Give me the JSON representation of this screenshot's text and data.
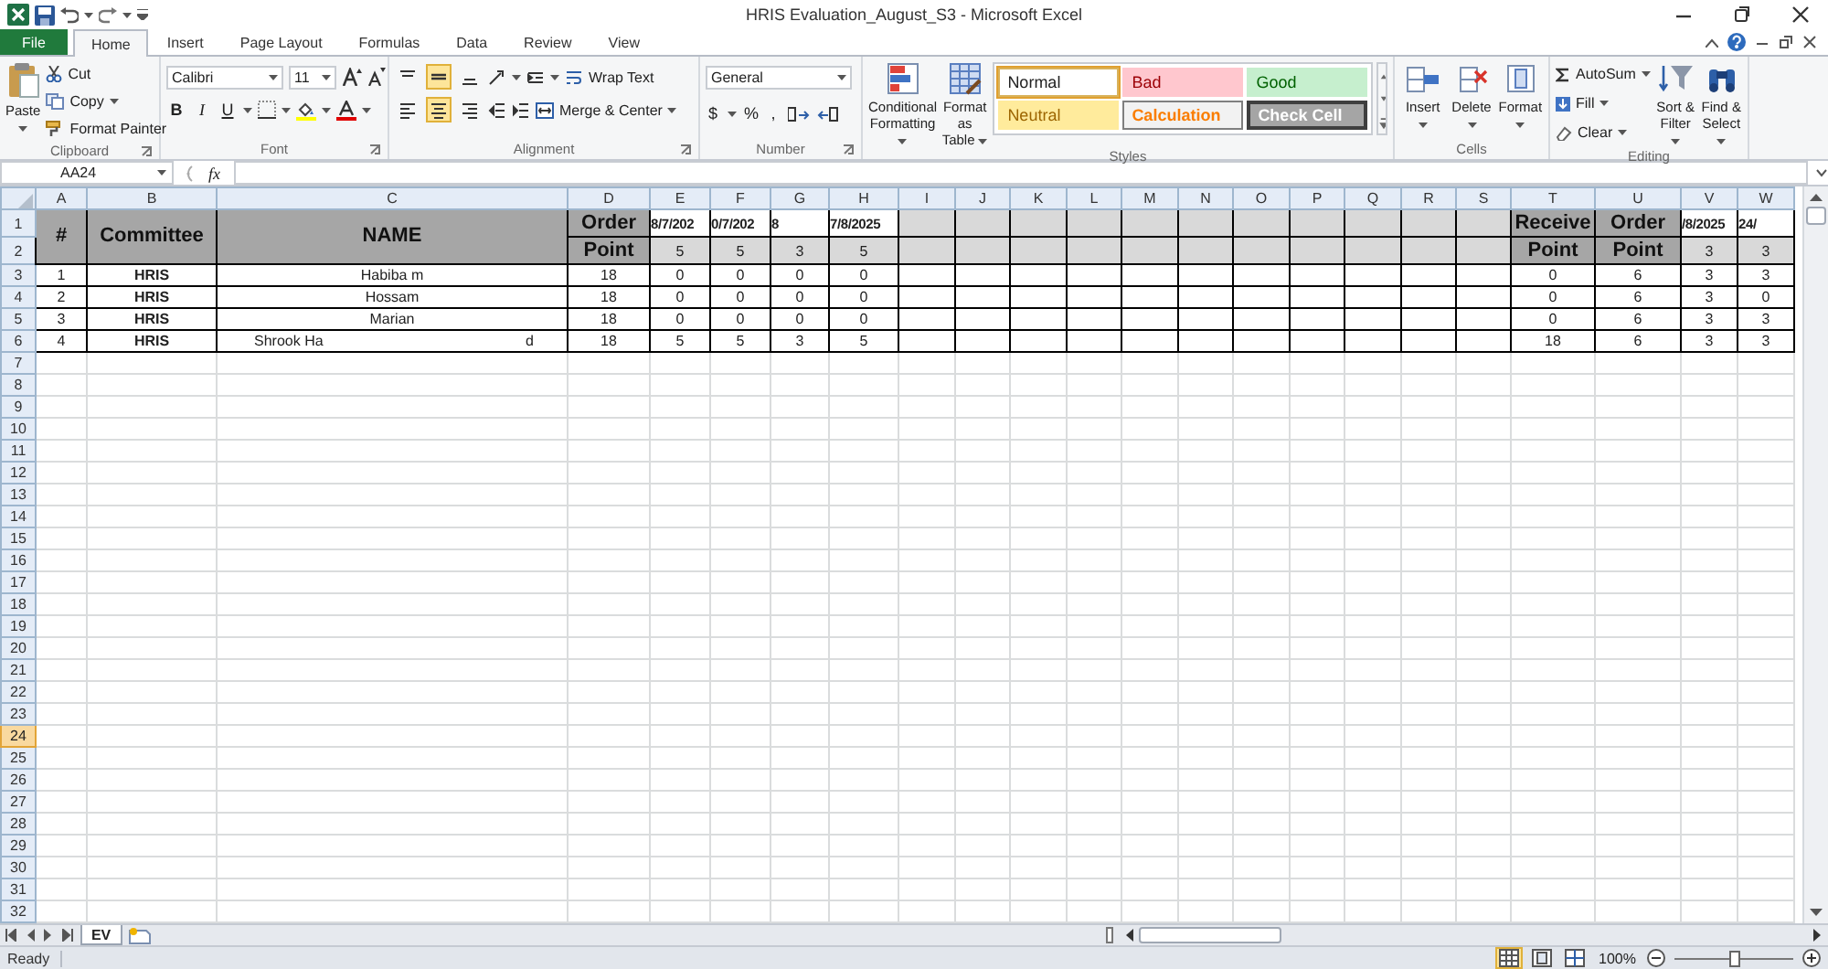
{
  "window": {
    "title": "HRIS Evaluation_August_S3 - Microsoft Excel"
  },
  "tabs": [
    {
      "label": "File",
      "kind": "file",
      "selected": false
    },
    {
      "label": "Home",
      "kind": "tab",
      "selected": true
    },
    {
      "label": "Insert",
      "kind": "tab",
      "selected": false
    },
    {
      "label": "Page Layout",
      "kind": "tab",
      "selected": false
    },
    {
      "label": "Formulas",
      "kind": "tab",
      "selected": false
    },
    {
      "label": "Data",
      "kind": "tab",
      "selected": false
    },
    {
      "label": "Review",
      "kind": "tab",
      "selected": false
    },
    {
      "label": "View",
      "kind": "tab",
      "selected": false
    }
  ],
  "ribbon": {
    "clipboard": {
      "title": "Clipboard",
      "paste": "Paste",
      "cut": "Cut",
      "copy": "Copy",
      "format_painter": "Format Painter"
    },
    "font": {
      "title": "Font",
      "font_name": "Calibri",
      "font_size": "11",
      "bold": "B",
      "italic": "I",
      "underline": "U"
    },
    "alignment": {
      "title": "Alignment",
      "wrap_text": "Wrap Text",
      "merge": "Merge & Center",
      "vertical_buttons": [
        {
          "selected": false
        },
        {
          "selected": true
        },
        {
          "selected": false
        }
      ],
      "horizontal_buttons": [
        {
          "selected": false
        },
        {
          "selected": true
        },
        {
          "selected": false
        }
      ]
    },
    "number": {
      "title": "Number",
      "format": "General",
      "currency": "$",
      "percent": "%",
      "comma": ","
    },
    "styles": {
      "title": "Styles",
      "conditional": "Conditional Formatting",
      "format_table": "Format as Table",
      "cell_styles": [
        {
          "label": "Normal",
          "kind": "normal",
          "selected": true
        },
        {
          "label": "Bad",
          "kind": "bad",
          "selected": false
        },
        {
          "label": "Good",
          "kind": "good",
          "selected": false
        },
        {
          "label": "Neutral",
          "kind": "neutral",
          "selected": false
        },
        {
          "label": "Calculation",
          "kind": "calculation",
          "selected": false
        },
        {
          "label": "Check Cell",
          "kind": "check",
          "selected": false
        }
      ]
    },
    "cells": {
      "title": "Cells",
      "items": [
        "Insert",
        "Delete",
        "Format"
      ]
    },
    "editing": {
      "title": "Editing",
      "autosum": "AutoSum",
      "fill": "Fill",
      "clear": "Clear",
      "sort": "Sort & Filter",
      "find": "Find & Select"
    }
  },
  "formula_bar": {
    "name_box": "AA24",
    "function_label": "fx"
  },
  "sheet": {
    "columns": [
      {
        "label": "A"
      },
      {
        "label": "B"
      },
      {
        "label": "C"
      },
      {
        "label": "D"
      },
      {
        "label": "E"
      },
      {
        "label": "F"
      },
      {
        "label": "G"
      },
      {
        "label": "H"
      },
      {
        "label": "I"
      },
      {
        "label": "J"
      },
      {
        "label": "K"
      },
      {
        "label": "L"
      },
      {
        "label": "M"
      },
      {
        "label": "N"
      },
      {
        "label": "O"
      },
      {
        "label": "P"
      },
      {
        "label": "Q"
      },
      {
        "label": "R"
      },
      {
        "label": "S"
      },
      {
        "label": "T"
      },
      {
        "label": "U"
      },
      {
        "label": "V"
      },
      {
        "label": "W"
      }
    ],
    "rows": [
      {
        "number": "1",
        "selected": false,
        "cells": [
          {
            "kind": "header",
            "text": "#",
            "merged_down": true
          },
          {
            "kind": "header",
            "text": "Committee",
            "merged_down": true
          },
          {
            "kind": "header",
            "text": "NAME",
            "merged_down": true
          },
          {
            "kind": "header",
            "text": "Order"
          },
          {
            "kind": "date",
            "text": "8/7/202"
          },
          {
            "kind": "date",
            "text": "0/7/202"
          },
          {
            "kind": "date",
            "text": "8"
          },
          {
            "kind": "date",
            "text": "7/8/2025"
          },
          {
            "kind": "light"
          },
          {
            "kind": "light"
          },
          {
            "kind": "light"
          },
          {
            "kind": "light"
          },
          {
            "kind": "light"
          },
          {
            "kind": "light"
          },
          {
            "kind": "light"
          },
          {
            "kind": "light"
          },
          {
            "kind": "light"
          },
          {
            "kind": "light"
          },
          {
            "kind": "light"
          },
          {
            "kind": "header",
            "text": "Receive"
          },
          {
            "kind": "header",
            "text": "Order"
          },
          {
            "kind": "date",
            "text": "/8/2025"
          },
          {
            "kind": "date",
            "text": "24/"
          }
        ]
      },
      {
        "number": "2",
        "selected": false,
        "cells": [
          {
            "kind": "header",
            "text": "Point"
          },
          {
            "kind": "light",
            "text": "5"
          },
          {
            "kind": "light",
            "text": "5"
          },
          {
            "kind": "light",
            "text": "3"
          },
          {
            "kind": "light",
            "text": "5"
          },
          {
            "kind": "light"
          },
          {
            "kind": "light"
          },
          {
            "kind": "light"
          },
          {
            "kind": "light"
          },
          {
            "kind": "light"
          },
          {
            "kind": "light"
          },
          {
            "kind": "light"
          },
          {
            "kind": "light"
          },
          {
            "kind": "light"
          },
          {
            "kind": "light"
          },
          {
            "kind": "light"
          },
          {
            "kind": "header",
            "text": "Point"
          },
          {
            "kind": "header",
            "text": "Point"
          },
          {
            "kind": "light",
            "text": "3"
          },
          {
            "kind": "light",
            "text": "3"
          }
        ]
      },
      {
        "number": "3",
        "selected": false,
        "cells": [
          {
            "kind": "plain",
            "text": "1"
          },
          {
            "kind": "strong",
            "text": "HRIS"
          },
          {
            "kind": "name",
            "text": "Habiba m"
          },
          {
            "kind": "plain",
            "text": "18"
          },
          {
            "kind": "plain",
            "text": "0"
          },
          {
            "kind": "plain",
            "text": "0"
          },
          {
            "kind": "plain",
            "text": "0"
          },
          {
            "kind": "plain",
            "text": "0"
          },
          {
            "kind": "plain"
          },
          {
            "kind": "plain"
          },
          {
            "kind": "plain"
          },
          {
            "kind": "plain"
          },
          {
            "kind": "plain"
          },
          {
            "kind": "plain"
          },
          {
            "kind": "plain"
          },
          {
            "kind": "plain"
          },
          {
            "kind": "plain"
          },
          {
            "kind": "plain"
          },
          {
            "kind": "plain"
          },
          {
            "kind": "plain",
            "text": "0"
          },
          {
            "kind": "plain",
            "text": "6"
          },
          {
            "kind": "plain",
            "text": "3"
          },
          {
            "kind": "plain",
            "text": "3"
          }
        ]
      },
      {
        "number": "4",
        "selected": false,
        "cells": [
          {
            "kind": "plain",
            "text": "2"
          },
          {
            "kind": "strong",
            "text": "HRIS"
          },
          {
            "kind": "name",
            "text": "Hossam"
          },
          {
            "kind": "plain",
            "text": "18"
          },
          {
            "kind": "plain",
            "text": "0"
          },
          {
            "kind": "plain",
            "text": "0"
          },
          {
            "kind": "plain",
            "text": "0"
          },
          {
            "kind": "plain",
            "text": "0"
          },
          {
            "kind": "plain"
          },
          {
            "kind": "plain"
          },
          {
            "kind": "plain"
          },
          {
            "kind": "plain"
          },
          {
            "kind": "plain"
          },
          {
            "kind": "plain"
          },
          {
            "kind": "plain"
          },
          {
            "kind": "plain"
          },
          {
            "kind": "plain"
          },
          {
            "kind": "plain"
          },
          {
            "kind": "plain"
          },
          {
            "kind": "plain",
            "text": "0"
          },
          {
            "kind": "plain",
            "text": "6"
          },
          {
            "kind": "plain",
            "text": "3"
          },
          {
            "kind": "plain",
            "text": "0"
          }
        ]
      },
      {
        "number": "5",
        "selected": false,
        "cells": [
          {
            "kind": "plain",
            "text": "3"
          },
          {
            "kind": "strong",
            "text": "HRIS"
          },
          {
            "kind": "name",
            "text": "Marian"
          },
          {
            "kind": "plain",
            "text": "18"
          },
          {
            "kind": "plain",
            "text": "0"
          },
          {
            "kind": "plain",
            "text": "0"
          },
          {
            "kind": "plain",
            "text": "0"
          },
          {
            "kind": "plain",
            "text": "0"
          },
          {
            "kind": "plain"
          },
          {
            "kind": "plain"
          },
          {
            "kind": "plain"
          },
          {
            "kind": "plain"
          },
          {
            "kind": "plain"
          },
          {
            "kind": "plain"
          },
          {
            "kind": "plain"
          },
          {
            "kind": "plain"
          },
          {
            "kind": "plain"
          },
          {
            "kind": "plain"
          },
          {
            "kind": "plain"
          },
          {
            "kind": "plain",
            "text": "0"
          },
          {
            "kind": "plain",
            "text": "6"
          },
          {
            "kind": "plain",
            "text": "3"
          },
          {
            "kind": "plain",
            "text": "3"
          }
        ]
      },
      {
        "number": "6",
        "selected": false,
        "cells": [
          {
            "kind": "plain",
            "text": "4"
          },
          {
            "kind": "strong",
            "text": "HRIS"
          },
          {
            "kind": "name",
            "text": "Shrook Ha",
            "tail": "d"
          },
          {
            "kind": "plain",
            "text": "18"
          },
          {
            "kind": "plain",
            "text": "5"
          },
          {
            "kind": "plain",
            "text": "5"
          },
          {
            "kind": "plain",
            "text": "3"
          },
          {
            "kind": "plain",
            "text": "5"
          },
          {
            "kind": "plain"
          },
          {
            "kind": "plain"
          },
          {
            "kind": "plain"
          },
          {
            "kind": "plain"
          },
          {
            "kind": "plain"
          },
          {
            "kind": "plain"
          },
          {
            "kind": "plain"
          },
          {
            "kind": "plain"
          },
          {
            "kind": "plain"
          },
          {
            "kind": "plain"
          },
          {
            "kind": "plain"
          },
          {
            "kind": "plain",
            "text": "18"
          },
          {
            "kind": "plain",
            "text": "6"
          },
          {
            "kind": "plain",
            "text": "3"
          },
          {
            "kind": "plain",
            "text": "3"
          }
        ]
      },
      {
        "number": "7",
        "selected": false
      },
      {
        "number": "8",
        "selected": false
      },
      {
        "number": "9",
        "selected": false
      },
      {
        "number": "10",
        "selected": false
      },
      {
        "number": "11",
        "selected": false
      },
      {
        "number": "12",
        "selected": false
      },
      {
        "number": "13",
        "selected": false
      },
      {
        "number": "14",
        "selected": false
      },
      {
        "number": "15",
        "selected": false
      },
      {
        "number": "16",
        "selected": false
      },
      {
        "number": "17",
        "selected": false
      },
      {
        "number": "18",
        "selected": false
      },
      {
        "number": "19",
        "selected": false
      },
      {
        "number": "20",
        "selected": false
      },
      {
        "number": "21",
        "selected": false
      },
      {
        "number": "22",
        "selected": false
      },
      {
        "number": "23",
        "selected": false
      },
      {
        "number": "24",
        "selected": true
      },
      {
        "number": "25",
        "selected": false
      },
      {
        "number": "26",
        "selected": false
      },
      {
        "number": "27",
        "selected": false
      },
      {
        "number": "28",
        "selected": false
      },
      {
        "number": "29",
        "selected": false
      },
      {
        "number": "30",
        "selected": false
      },
      {
        "number": "31",
        "selected": false
      },
      {
        "number": "32",
        "selected": false
      }
    ],
    "tabs": [
      {
        "label": "EV",
        "selected": true
      }
    ]
  },
  "status_bar": {
    "text": "Ready",
    "views": [
      {
        "selected": true
      },
      {
        "selected": false
      },
      {
        "selected": false
      }
    ],
    "zoom": {
      "label": "100%",
      "level": 0.5
    }
  }
}
